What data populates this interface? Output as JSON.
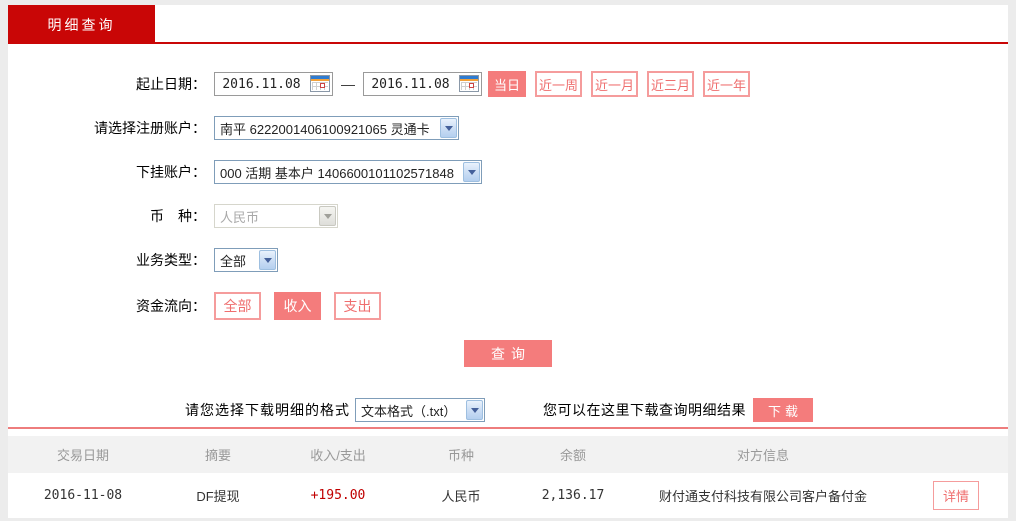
{
  "tab": {
    "label": "明细查询"
  },
  "form": {
    "date_range": {
      "label": "起止日期：",
      "start": "2016.11.08",
      "end": "2016.11.08",
      "separator": "—",
      "quick_buttons": [
        {
          "label": "当日",
          "active": true
        },
        {
          "label": "近一周",
          "active": false
        },
        {
          "label": "近一月",
          "active": false
        },
        {
          "label": "近三月",
          "active": false
        },
        {
          "label": "近一年",
          "active": false
        }
      ]
    },
    "register_account": {
      "label": "请选择注册账户：",
      "value": "南平 6222001406100921065 灵通卡"
    },
    "sub_account": {
      "label": "下挂账户：",
      "value": "000 活期 基本户 1406600101102571848"
    },
    "currency": {
      "label": "币　种：",
      "value": "人民币",
      "disabled": true
    },
    "business_type": {
      "label": "业务类型：",
      "value": "全部"
    },
    "fund_flow": {
      "label": "资金流向：",
      "options": [
        {
          "label": "全部",
          "active": false
        },
        {
          "label": "收入",
          "active": true
        },
        {
          "label": "支出",
          "active": false
        }
      ]
    },
    "query_button": "查询"
  },
  "download": {
    "format_label": "请您选择下载明细的格式",
    "format_value": "文本格式（.txt）",
    "hint": "您可以在这里下载查询明细结果",
    "button": "下载"
  },
  "table": {
    "headers": [
      "交易日期",
      "摘要",
      "收入/支出",
      "币种",
      "余额",
      "对方信息"
    ],
    "rows": [
      {
        "date": "2016-11-08",
        "summary": "DF提现",
        "amount": "+195.00",
        "currency": "人民币",
        "balance": "2,136.17",
        "counterparty": "财付通支付科技有限公司客户备付金",
        "detail_label": "详情"
      }
    ]
  },
  "colors": {
    "brand_red": "#c90606",
    "accent_salmon": "#f47c7c",
    "amount_red": "#c00000"
  }
}
